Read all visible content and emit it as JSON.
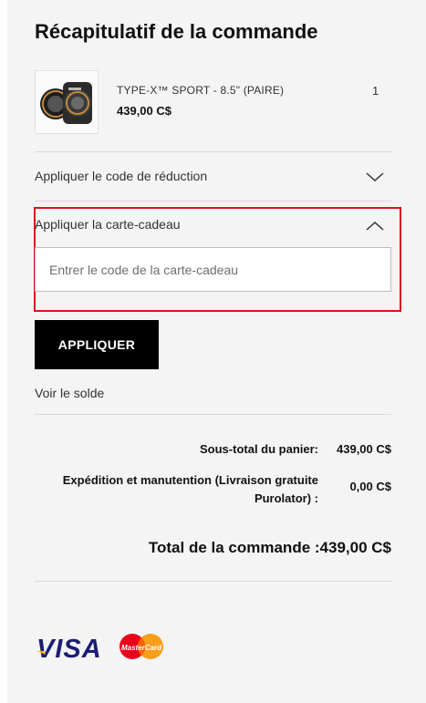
{
  "summary": {
    "title": "Récapitulatif de la commande"
  },
  "item": {
    "name": "TYPE-X™ SPORT - 8.5\" (PAIRE)",
    "price": "439,00 C$",
    "quantity": "1"
  },
  "discount": {
    "label": "Appliquer le code de réduction",
    "icon": "chevron-down-icon"
  },
  "gift_card": {
    "label": "Appliquer la carte-cadeau",
    "icon": "chevron-up-icon",
    "placeholder": "Entrer le code de la carte-cadeau",
    "value": "",
    "button_label": "APPLIQUER",
    "balance_link": "Voir le solde",
    "highlight_color": "#d8141d"
  },
  "totals": {
    "subtotal_label": "Sous-total du panier:",
    "subtotal_value": "439,00 C$",
    "shipping_label_line1": "Expédition et manutention (Livraison gratuite",
    "shipping_label_line2": "Purolator) :",
    "shipping_value": "0,00 C$",
    "order_total_label": "Total de la commande :",
    "order_total_value": "439,00 C$"
  },
  "payment": {
    "visa": "VISA",
    "mastercard": "MasterCard"
  }
}
